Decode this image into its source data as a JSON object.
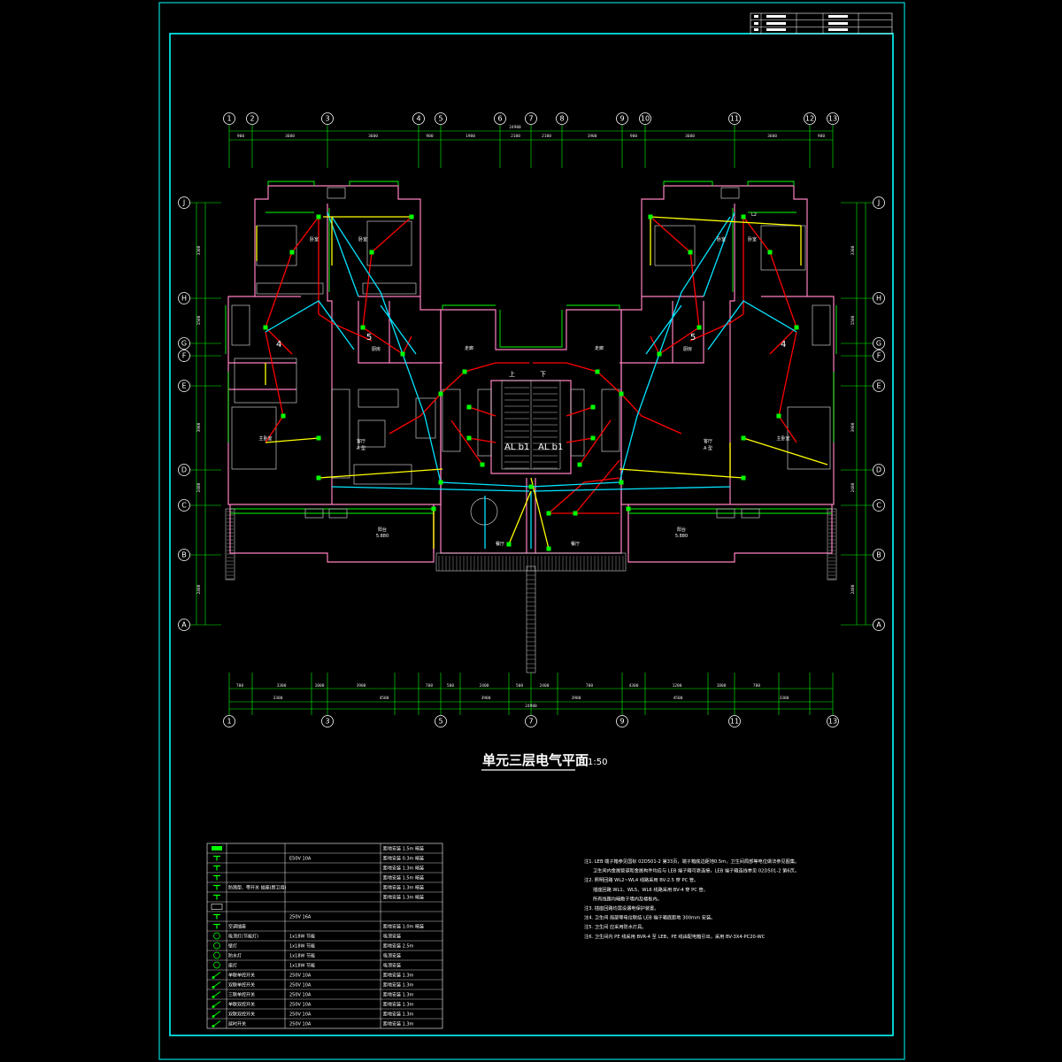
{
  "drawing": {
    "title": "单元三层电气平面",
    "scale": "1:50",
    "palette": {
      "frame": "#00ffff",
      "wall": "#ff80c0",
      "window": "#00ff00",
      "wire_red": "#ff0000",
      "wire_cyan": "#00e5ff",
      "wire_yellow": "#ffff00",
      "fixture": "#c8c8c8"
    }
  },
  "grid": {
    "columns_top": [
      "1",
      "2",
      "3",
      "4",
      "5",
      "6",
      "7",
      "8",
      "9",
      "10",
      "11",
      "12",
      "13"
    ],
    "columns_bottom": [
      "1",
      "3",
      "5",
      "7",
      "9",
      "11",
      "13"
    ],
    "rows": [
      "J",
      "H",
      "G",
      "F",
      "E",
      "D",
      "C",
      "B",
      "A"
    ]
  },
  "dims": {
    "top_segments": [
      "900",
      "3600",
      "3600",
      "900",
      "1900",
      "2100",
      "2100",
      "1900",
      "900",
      "3600",
      "3600",
      "900"
    ],
    "top_total": "24900",
    "bottom_row1": [
      "700",
      "3300",
      "1000",
      "3900",
      "700",
      "500",
      "2400",
      "500",
      "2400",
      "700",
      "4300",
      "1200",
      "1800",
      "700"
    ],
    "bottom_row2": [
      "3300",
      "4500",
      "3900",
      "3900",
      "4500",
      "3300"
    ],
    "bottom_total": "24900",
    "left_side": [
      "3300",
      "1500",
      "3900",
      "2400",
      "2400"
    ],
    "right_side": [
      "3300",
      "1500",
      "3900",
      "2400",
      "2400"
    ]
  },
  "rooms": {
    "bedroom_top_left_1": "卧室",
    "bedroom_top_left_2": "卧室",
    "bedroom_top_right_1": "卧室",
    "bedroom_top_right_2": "卧室",
    "bath_left": "厨房",
    "bath_right": "厨房",
    "master_left": "主卧室",
    "master_right": "主卧室",
    "living_left": "客厅",
    "living_left_sub": "A 型",
    "living_right": "客厅",
    "living_right_sub": "A 型",
    "kitchen_left": "走廊",
    "kitchen_right": "走廊",
    "balcony_left": "阳台",
    "balcony_right": "阳台",
    "balcony_area": "5.880",
    "balcony_area_right": "5.880",
    "hall_left": "餐厅",
    "hall_right": "餐厅",
    "stair_up": "上",
    "stair_down": "下",
    "panel_left": "AL b1",
    "panel_right": "AL b1",
    "circuit_4_left": "4",
    "circuit_5_left": "5",
    "circuit_4_right": "4",
    "circuit_5_right": "5",
    "label_l2": "L2"
  },
  "title_block": {
    "rows": [
      [
        "",
        "",
        "",
        "",
        ""
      ],
      [
        "",
        "",
        "",
        "",
        ""
      ],
      [
        "",
        "",
        "",
        "",
        ""
      ]
    ]
  },
  "legend": {
    "rows": [
      {
        "icon": "panel-icon",
        "name": "",
        "spec": "",
        "note": "距地安装 1.5m 暗装"
      },
      {
        "icon": "socket-icon",
        "name": "",
        "spec": "E50V 10A",
        "note": "距地安装 0.3m 暗装"
      },
      {
        "icon": "socket-icon",
        "name": "",
        "spec": "",
        "note": "距地安装 1.3m 暗装"
      },
      {
        "icon": "socket-icon",
        "name": "",
        "spec": "",
        "note": "距地安装 1.5m 暗装"
      },
      {
        "icon": "socket-icon",
        "name": "防溅型、带开关 插座(厨卫用)",
        "spec": "",
        "note": "距地安装 1.3m 暗装"
      },
      {
        "icon": "socket-icon",
        "name": "",
        "spec": "",
        "note": "距地安装 1.3m 暗装"
      },
      {
        "icon": "box-icon",
        "name": "",
        "spec": "",
        "note": ""
      },
      {
        "icon": "socket-icon",
        "name": "",
        "spec": "250V 16A",
        "note": ""
      },
      {
        "icon": "socket-icon",
        "name": "空调插座",
        "spec": "",
        "note": "距地安装 1.0m 暗装"
      },
      {
        "icon": "lamp-icon",
        "name": "吸顶灯(节能灯)",
        "spec": "1x18W 节能",
        "note": "吸顶安装"
      },
      {
        "icon": "lamp-icon",
        "name": "壁灯",
        "spec": "1x18W 节能",
        "note": "距地安装 2.5m"
      },
      {
        "icon": "lamp-icon",
        "name": "防水灯",
        "spec": "1x18W 节能",
        "note": "吸顶安装"
      },
      {
        "icon": "lamp-icon",
        "name": "座灯",
        "spec": "1x18W 节能",
        "note": "吸顶安装"
      },
      {
        "icon": "switch-icon",
        "name": "单联单控开关",
        "spec": "250V 10A",
        "note": "距地安装 1.3m"
      },
      {
        "icon": "switch-icon",
        "name": "双联单控开关",
        "spec": "250V 10A",
        "note": "距地安装 1.3m"
      },
      {
        "icon": "switch-icon",
        "name": "三联单控开关",
        "spec": "250V 10A",
        "note": "距地安装 1.3m"
      },
      {
        "icon": "switch-icon",
        "name": "单联双控开关",
        "spec": "250V 10A",
        "note": "距地安装 1.3m"
      },
      {
        "icon": "switch-icon",
        "name": "双联双控开关",
        "spec": "250V 10A",
        "note": "距地安装 1.3m"
      },
      {
        "icon": "switch-icon",
        "name": "延时开关",
        "spec": "250V 10A",
        "note": "距地安装 1.3m"
      }
    ]
  },
  "notes": [
    "注1. LEB 端子箱参见国标 02D501-2 第33页，端子箱底边距地0.5m，卫生间局部等电位做法参见图集。",
    "卫生间内金属管道和金属构件均应与 LEB 端子箱可靠连接，LEB 端子箱连线参见 02D501-2 第6页。",
    "注2. 照明回路 WL2~WL4 线路采用 BV-2.5 穿 PC 管。",
    "插座回路 WL1、WL5、WL6 线路采用 BV-4 穿 PC 管。",
    "所有线路均暗敷于墙内及楼板内。",
    "注3. 插座回路均需设漏电保护装置。",
    "注4. 卫生间 局部等电位联结 LEB 端子箱底距地 300mm 安装。",
    "注5. 卫生间 应采用防水灯具。",
    "注6. 卫生间内 PE 线采用 BVR-4 至 LEB，PE 线由配电箱引出，采用 BV-3X4-PC20-WC"
  ]
}
